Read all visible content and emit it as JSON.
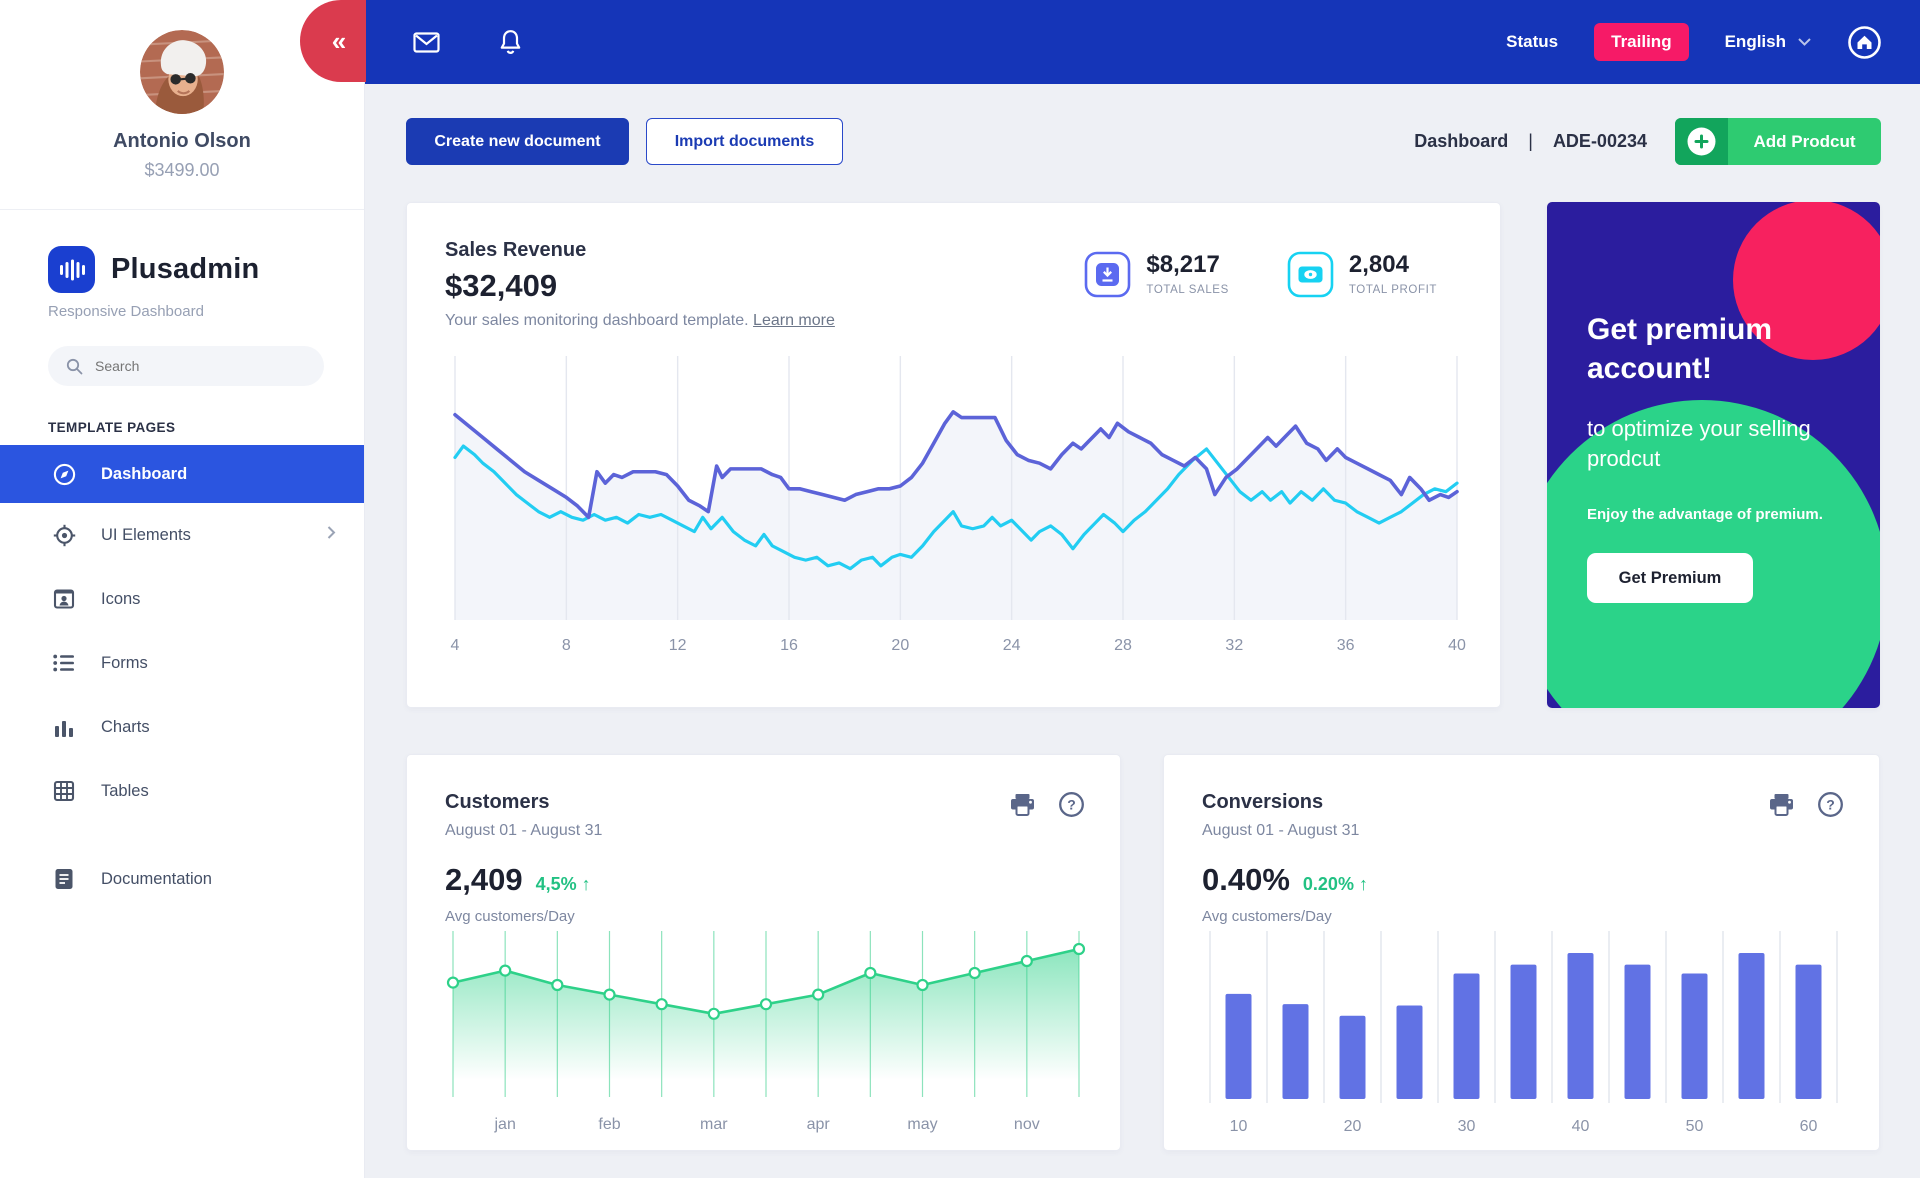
{
  "topbar": {
    "collapse_glyph": "«",
    "status_label": "Status",
    "trailing_label": "Trailing",
    "language_label": "English"
  },
  "actions": {
    "create_label": "Create new document",
    "import_label": "Import documents",
    "breadcrumb": "Dashboard",
    "separator": "|",
    "doc_id": "ADE-00234",
    "add_product_label": "Add Prodcut",
    "add_product_plus": "+"
  },
  "sidebar": {
    "profile": {
      "name": "Antonio Olson",
      "balance": "$3499.00"
    },
    "brand": {
      "name": "Plusadmin",
      "tagline": "Responsive Dashboard"
    },
    "search": {
      "placeholder": "Search"
    },
    "section_label": "TEMPLATE PAGES",
    "items": [
      {
        "label": "Dashboard"
      },
      {
        "label": "UI Elements"
      },
      {
        "label": "Icons"
      },
      {
        "label": "Forms"
      },
      {
        "label": "Charts"
      },
      {
        "label": "Tables"
      },
      {
        "label": "Documentation"
      }
    ]
  },
  "sales_card": {
    "title": "Sales Revenue",
    "value": "$32,409",
    "subtitle": "Your sales monitoring dashboard template.",
    "learn_more": "Learn more",
    "stats": [
      {
        "value": "$8,217",
        "label": "TOTAL SALES"
      },
      {
        "value": "2,804",
        "label": "TOTAL PROFIT"
      }
    ]
  },
  "premium_card": {
    "title_line1": "Get premium",
    "title_line2": "account!",
    "subtitle": "to optimize your selling prodcut",
    "note": "Enjoy the advantage of premium.",
    "button_label": "Get Premium"
  },
  "customers_card": {
    "title": "Customers",
    "date_range": "August 01 - August 31",
    "value": "2,409",
    "delta": "4,5%",
    "delta_arrow": "↑",
    "caption": "Avg customers/Day"
  },
  "conversions_card": {
    "title": "Conversions",
    "date_range": "August 01 - August 31",
    "value": "0.40%",
    "delta": "0.20%",
    "delta_arrow": "↑",
    "caption": "Avg customers/Day"
  },
  "chart_data": [
    {
      "type": "line",
      "title": "Sales Revenue",
      "xlabel": "",
      "ylabel": "",
      "xlim": [
        4,
        40
      ],
      "ylim": [
        0,
        100
      ],
      "x_ticks": [
        4,
        8,
        12,
        16,
        20,
        24,
        28,
        32,
        36,
        40
      ],
      "grid": "vertical",
      "legend": "none",
      "area_fill": "#f3f5fa",
      "grid_color": "#e4e7ef",
      "series": [
        {
          "name": "revenue-primary",
          "color": "#5c63d8",
          "points": [
            [
              4,
              72
            ],
            [
              4.5,
              68
            ],
            [
              5,
              64
            ],
            [
              5.5,
              60
            ],
            [
              6,
              56
            ],
            [
              6.5,
              52
            ],
            [
              7,
              49
            ],
            [
              7.5,
              46
            ],
            [
              8,
              43
            ],
            [
              8.4,
              40
            ],
            [
              8.8,
              36
            ],
            [
              9.1,
              52
            ],
            [
              9.4,
              48
            ],
            [
              9.7,
              51
            ],
            [
              10,
              50
            ],
            [
              10.4,
              52
            ],
            [
              10.8,
              52
            ],
            [
              11.2,
              52
            ],
            [
              11.6,
              51
            ],
            [
              12,
              47
            ],
            [
              12.4,
              42
            ],
            [
              12.8,
              40
            ],
            [
              13.1,
              38
            ],
            [
              13.4,
              54
            ],
            [
              13.6,
              50
            ],
            [
              13.9,
              53
            ],
            [
              14.3,
              53
            ],
            [
              14.7,
              53
            ],
            [
              15,
              53
            ],
            [
              15.4,
              51
            ],
            [
              15.7,
              50
            ],
            [
              16,
              46
            ],
            [
              16.4,
              46
            ],
            [
              16.8,
              45
            ],
            [
              17.2,
              44
            ],
            [
              17.6,
              43
            ],
            [
              18,
              42
            ],
            [
              18.4,
              44
            ],
            [
              18.8,
              45
            ],
            [
              19.2,
              46
            ],
            [
              19.6,
              46
            ],
            [
              20,
              47
            ],
            [
              20.4,
              50
            ],
            [
              20.8,
              55
            ],
            [
              21.2,
              62
            ],
            [
              21.6,
              69
            ],
            [
              21.9,
              73
            ],
            [
              22.2,
              71
            ],
            [
              22.6,
              71
            ],
            [
              23,
              71
            ],
            [
              23.4,
              71
            ],
            [
              23.8,
              63
            ],
            [
              24.2,
              58
            ],
            [
              24.6,
              56
            ],
            [
              25,
              55
            ],
            [
              25.4,
              53
            ],
            [
              25.8,
              58
            ],
            [
              26.2,
              62
            ],
            [
              26.5,
              60
            ],
            [
              26.9,
              64
            ],
            [
              27.2,
              67
            ],
            [
              27.5,
              64
            ],
            [
              27.8,
              69
            ],
            [
              28.2,
              66
            ],
            [
              28.6,
              64
            ],
            [
              29,
              62
            ],
            [
              29.4,
              58
            ],
            [
              29.8,
              56
            ],
            [
              30.2,
              54
            ],
            [
              30.6,
              57
            ],
            [
              31,
              53
            ],
            [
              31.3,
              44
            ],
            [
              31.7,
              50
            ],
            [
              32.1,
              53
            ],
            [
              32.5,
              57
            ],
            [
              32.9,
              61
            ],
            [
              33.2,
              64
            ],
            [
              33.5,
              61
            ],
            [
              33.9,
              65
            ],
            [
              34.2,
              68
            ],
            [
              34.6,
              62
            ],
            [
              35,
              60
            ],
            [
              35.3,
              56
            ],
            [
              35.7,
              60
            ],
            [
              36,
              57
            ],
            [
              36.4,
              55
            ],
            [
              36.8,
              53
            ],
            [
              37.2,
              51
            ],
            [
              37.6,
              49
            ],
            [
              38,
              44
            ],
            [
              38.3,
              50
            ],
            [
              38.7,
              46
            ],
            [
              39,
              42
            ],
            [
              39.4,
              44
            ],
            [
              39.7,
              43
            ],
            [
              40,
              45
            ]
          ]
        },
        {
          "name": "revenue-secondary",
          "color": "#22cdf2",
          "points": [
            [
              4,
              57
            ],
            [
              4.3,
              61
            ],
            [
              4.7,
              58
            ],
            [
              5,
              55
            ],
            [
              5.4,
              52
            ],
            [
              5.8,
              48
            ],
            [
              6.2,
              44
            ],
            [
              6.6,
              41
            ],
            [
              7,
              38
            ],
            [
              7.4,
              36
            ],
            [
              7.8,
              38
            ],
            [
              8.2,
              36
            ],
            [
              8.6,
              35
            ],
            [
              9,
              37
            ],
            [
              9.4,
              35
            ],
            [
              9.8,
              36
            ],
            [
              10.2,
              34
            ],
            [
              10.6,
              37
            ],
            [
              11,
              36
            ],
            [
              11.4,
              37
            ],
            [
              11.8,
              35
            ],
            [
              12.2,
              33
            ],
            [
              12.6,
              31
            ],
            [
              12.9,
              36
            ],
            [
              13.2,
              32
            ],
            [
              13.6,
              36
            ],
            [
              14,
              31
            ],
            [
              14.4,
              28
            ],
            [
              14.8,
              26
            ],
            [
              15.1,
              30
            ],
            [
              15.4,
              26
            ],
            [
              15.8,
              24
            ],
            [
              16.2,
              22
            ],
            [
              16.6,
              21
            ],
            [
              17,
              22
            ],
            [
              17.4,
              19
            ],
            [
              17.8,
              20
            ],
            [
              18.2,
              18
            ],
            [
              18.6,
              21
            ],
            [
              19,
              22
            ],
            [
              19.3,
              19
            ],
            [
              19.7,
              22
            ],
            [
              20,
              23
            ],
            [
              20.4,
              22
            ],
            [
              20.8,
              26
            ],
            [
              21.2,
              31
            ],
            [
              21.6,
              35
            ],
            [
              21.9,
              38
            ],
            [
              22.2,
              33
            ],
            [
              22.6,
              32
            ],
            [
              23,
              33
            ],
            [
              23.3,
              36
            ],
            [
              23.6,
              33
            ],
            [
              24,
              35
            ],
            [
              24.3,
              32
            ],
            [
              24.7,
              28
            ],
            [
              25,
              31
            ],
            [
              25.4,
              33
            ],
            [
              25.8,
              30
            ],
            [
              26.2,
              25
            ],
            [
              26.6,
              30
            ],
            [
              27,
              34
            ],
            [
              27.3,
              37
            ],
            [
              27.7,
              34
            ],
            [
              28,
              31
            ],
            [
              28.4,
              35
            ],
            [
              28.8,
              38
            ],
            [
              29.2,
              42
            ],
            [
              29.6,
              46
            ],
            [
              30,
              51
            ],
            [
              30.5,
              56
            ],
            [
              31,
              60
            ],
            [
              31.4,
              55
            ],
            [
              31.8,
              50
            ],
            [
              32.2,
              45
            ],
            [
              32.6,
              42
            ],
            [
              33,
              45
            ],
            [
              33.3,
              42
            ],
            [
              33.7,
              45
            ],
            [
              34,
              41
            ],
            [
              34.4,
              45
            ],
            [
              34.8,
              42
            ],
            [
              35.2,
              46
            ],
            [
              35.6,
              42
            ],
            [
              36,
              41
            ],
            [
              36.4,
              38
            ],
            [
              36.8,
              36
            ],
            [
              37.2,
              34
            ],
            [
              37.6,
              36
            ],
            [
              38,
              38
            ],
            [
              38.4,
              41
            ],
            [
              38.8,
              44
            ],
            [
              39.2,
              46
            ],
            [
              39.6,
              45
            ],
            [
              40,
              48
            ]
          ]
        }
      ]
    },
    {
      "type": "area",
      "title": "Customers — Avg customers/Day",
      "categories": [
        "",
        "jan",
        "",
        "feb",
        "",
        "mar",
        "",
        "apr",
        "",
        "may",
        "",
        "nov",
        ""
      ],
      "values": [
        62,
        67,
        61,
        57,
        53,
        49,
        53,
        57,
        66,
        61,
        66,
        71,
        76
      ],
      "label_indices": [
        1,
        3,
        5,
        7,
        9,
        11
      ],
      "line_color": "#2ed189",
      "tick_color": "#8ce3bc",
      "marker": "circle-open",
      "ylim": [
        0,
        100
      ]
    },
    {
      "type": "bar",
      "title": "Conversions — Avg customers/Day",
      "categories": [
        "10",
        "",
        "20",
        "",
        "30",
        "",
        "40",
        "",
        "50",
        "",
        "60"
      ],
      "values": [
        0.72,
        0.65,
        0.57,
        0.64,
        0.86,
        0.92,
        1.0,
        0.92,
        0.86,
        1.0,
        0.92
      ],
      "label_indices": [
        0,
        2,
        4,
        6,
        8,
        10
      ],
      "bar_color": "#6172e4",
      "grid_color": "#dfe3ec",
      "ylim": [
        0,
        1
      ]
    }
  ],
  "colors": {
    "topbar": "#1535b8",
    "collapse_tab": "#da3b4e",
    "trailing_pill": "#f61a67",
    "active_item": "#2b55e0",
    "green_button": "#2ecb71",
    "premium_bg": "#2b1d9e",
    "premium_green": "#2bd389",
    "premium_pink": "#f7215f",
    "delta_green": "#22c183"
  }
}
